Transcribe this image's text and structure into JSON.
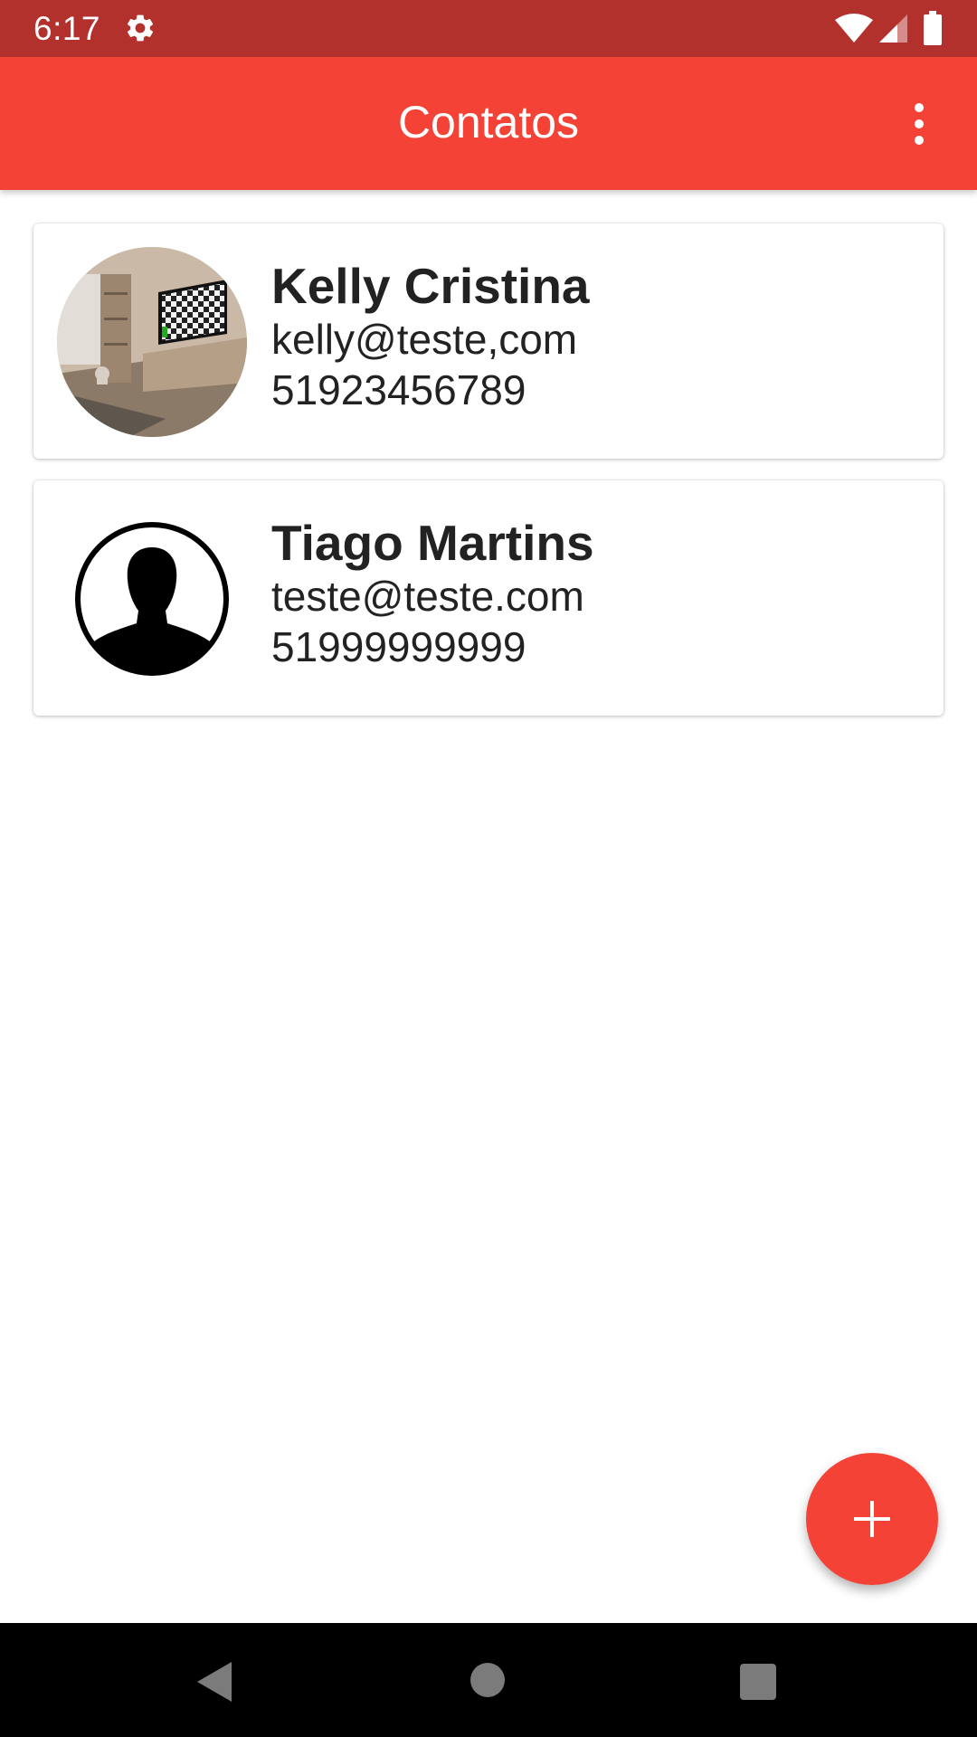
{
  "status_bar": {
    "time": "6:17",
    "icons": [
      "gear-icon",
      "wifi-icon",
      "cell-signal-icon",
      "battery-icon"
    ]
  },
  "app_bar": {
    "title": "Contatos",
    "overflow_icon": "more-vert-icon"
  },
  "contacts": [
    {
      "name": "Kelly Cristina",
      "email": "kelly@teste,com",
      "phone": "51923456789",
      "avatar": "photo"
    },
    {
      "name": "Tiago Martins",
      "email": "teste@teste.com",
      "phone": "51999999999",
      "avatar": "default-person-icon"
    }
  ],
  "fab": {
    "icon": "plus-icon"
  },
  "nav_bar": {
    "icons": [
      "back-icon",
      "home-icon",
      "recents-icon"
    ]
  },
  "colors": {
    "primary": "#f44336",
    "primary_dark": "#b3312c",
    "text": "#222222"
  }
}
